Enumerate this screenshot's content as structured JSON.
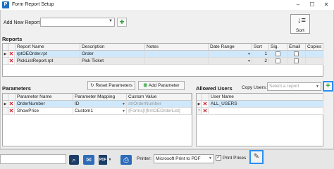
{
  "window": {
    "title": "Form Report Setup",
    "app_icon_letter": "P",
    "controls": [
      "–",
      "☐",
      "✕"
    ]
  },
  "toolbar": {
    "add_new_report_label": "Add New Report:",
    "add_new_report_value": "",
    "sort_label": "Sort"
  },
  "reports": {
    "section_title": "Reports",
    "columns": [
      "Report Name",
      "Description",
      "Notes",
      "Date Range",
      "Sort",
      "Sig.",
      "Email",
      "Copies"
    ],
    "rows": [
      {
        "name": "rptOEOrder.rpt",
        "description": "Order",
        "notes": "",
        "date_range": "",
        "sort": "1",
        "sig": false,
        "email": false,
        "copies": "",
        "selected": true
      },
      {
        "name": "PickListReport.rpt",
        "description": "Pick Ticket",
        "notes": "",
        "date_range": "",
        "sort": "2",
        "sig": false,
        "email": false,
        "copies": "",
        "selected": false
      }
    ]
  },
  "parameters": {
    "section_title": "Parameters",
    "reset_button": "Reset Parameters",
    "add_button": "Add Parameter",
    "columns": [
      "Parameter Name",
      "Parameter Mapping",
      "Custom Value"
    ],
    "rows": [
      {
        "name": "OrderNumber",
        "mapping": "ID",
        "custom_value": "strOrderNumber",
        "selected": true
      },
      {
        "name": "ShowPrice",
        "mapping": "Custom1",
        "custom_value": "{Forms}![frmOEOrderList]",
        "selected": false
      }
    ]
  },
  "allowed_users": {
    "section_title": "Allowed Users",
    "copy_users_label": "Copy Users:",
    "copy_users_placeholder": "Select a report",
    "columns": [
      "User Name"
    ],
    "rows": [
      {
        "name": "ALL_USERS",
        "selected": true
      },
      {
        "name": "",
        "selected": false
      }
    ]
  },
  "bottom_toolbar": {
    "printer_label": "Printer:",
    "printer_value": "Microsoft Print to PDF",
    "print_prices_label": "Print Prices",
    "print_prices_checked": true,
    "icons": [
      "search-doc-icon",
      "email-icon",
      "pdf-icon",
      "printer-icon",
      "edit-icon"
    ]
  },
  "colors": {
    "selected_row": "#cfe8fb",
    "delete_red": "#d0202a",
    "add_green": "#1f9d2d",
    "highlight_blue": "#2a8ff0"
  }
}
